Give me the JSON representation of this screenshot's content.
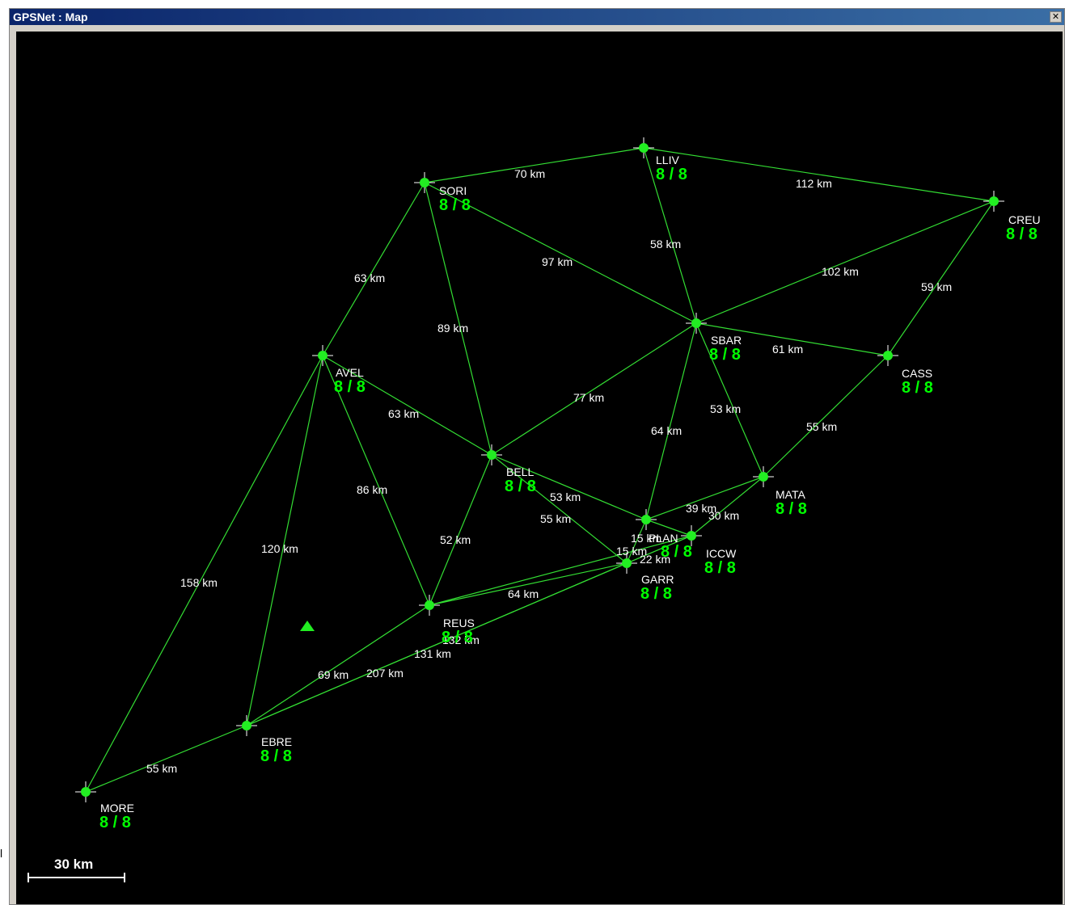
{
  "window": {
    "title": "GPSNet : Map",
    "close_icon": "close-icon"
  },
  "colors": {
    "line": "#33dd33",
    "station": "#22ee22",
    "status": "#00ff00",
    "text": "#ffffff",
    "background": "#000000"
  },
  "stations": [
    {
      "id": "SORI",
      "name": "SORI",
      "status": "8 / 8"
    },
    {
      "id": "LLIV",
      "name": "LLIV",
      "status": "8 / 8"
    },
    {
      "id": "CREU",
      "name": "CREU",
      "status": "8 / 8"
    },
    {
      "id": "AVEL",
      "name": "AVEL",
      "status": "8 / 8"
    },
    {
      "id": "SBAR",
      "name": "SBAR",
      "status": "8 / 8"
    },
    {
      "id": "CASS",
      "name": "CASS",
      "status": "8 / 8"
    },
    {
      "id": "BELL",
      "name": "BELL",
      "status": "8 / 8"
    },
    {
      "id": "MATA",
      "name": "MATA",
      "status": "8 / 8"
    },
    {
      "id": "PLAN",
      "name": "PLAN",
      "status": "8 / 8"
    },
    {
      "id": "ICCW",
      "name": "ICCW",
      "status": "8 / 8"
    },
    {
      "id": "GARR",
      "name": "GARR",
      "status": "8 / 8"
    },
    {
      "id": "REUS",
      "name": "REUS",
      "status": "8 / 8"
    },
    {
      "id": "EBRE",
      "name": "EBRE",
      "status": "8 / 8"
    },
    {
      "id": "MORE",
      "name": "MORE",
      "status": "8 / 8"
    }
  ],
  "baselines": [
    {
      "from": "SORI",
      "to": "LLIV",
      "label": "70 km"
    },
    {
      "from": "LLIV",
      "to": "CREU",
      "label": "112 km"
    },
    {
      "from": "LLIV",
      "to": "SBAR",
      "label": "58 km"
    },
    {
      "from": "SORI",
      "to": "SBAR",
      "label": "97 km"
    },
    {
      "from": "SBAR",
      "to": "CREU",
      "label": "102 km"
    },
    {
      "from": "CREU",
      "to": "CASS",
      "label": "59 km"
    },
    {
      "from": "SORI",
      "to": "AVEL",
      "label": "63 km"
    },
    {
      "from": "SORI",
      "to": "BELL",
      "label": "89 km"
    },
    {
      "from": "SBAR",
      "to": "CASS",
      "label": "61 km"
    },
    {
      "from": "BELL",
      "to": "SBAR",
      "label": "77 km"
    },
    {
      "from": "AVEL",
      "to": "BELL",
      "label": "63 km"
    },
    {
      "from": "SBAR",
      "to": "MATA",
      "label": "53 km"
    },
    {
      "from": "CASS",
      "to": "MATA",
      "label": "55 km"
    },
    {
      "from": "SBAR",
      "to": "PLAN",
      "label": "64 km"
    },
    {
      "from": "AVEL",
      "to": "REUS",
      "label": "86 km"
    },
    {
      "from": "BELL",
      "to": "PLAN",
      "label": "53 km"
    },
    {
      "from": "PLAN",
      "to": "MATA",
      "label": "39 km"
    },
    {
      "from": "MATA",
      "to": "ICCW",
      "label": "30 km"
    },
    {
      "from": "BELL",
      "to": "GARR",
      "label": "55 km"
    },
    {
      "from": "PLAN",
      "to": "ICCW",
      "label": "15 km"
    },
    {
      "from": "AVEL",
      "to": "EBRE",
      "label": "120 km"
    },
    {
      "from": "BELL",
      "to": "REUS",
      "label": "52 km"
    },
    {
      "from": "PLAN",
      "to": "GARR",
      "label": "15 km"
    },
    {
      "from": "GARR",
      "to": "ICCW",
      "label": "22 km"
    },
    {
      "from": "AVEL",
      "to": "MORE",
      "label": "158 km"
    },
    {
      "from": "REUS",
      "to": "GARR",
      "label": "64 km"
    },
    {
      "from": "REUS",
      "to": "ICCW",
      "label": "132 km"
    },
    {
      "from": "EBRE",
      "to": "GARR",
      "label": "131 km"
    },
    {
      "from": "EBRE",
      "to": "REUS",
      "label": "69 km"
    },
    {
      "from": "EBRE",
      "to": "ICCW",
      "label": "207 km"
    },
    {
      "from": "EBRE",
      "to": "MORE",
      "label": "55 km"
    }
  ],
  "scale_bar": {
    "label": "30 km"
  },
  "marker": {
    "icon": "triangle-marker-icon"
  }
}
